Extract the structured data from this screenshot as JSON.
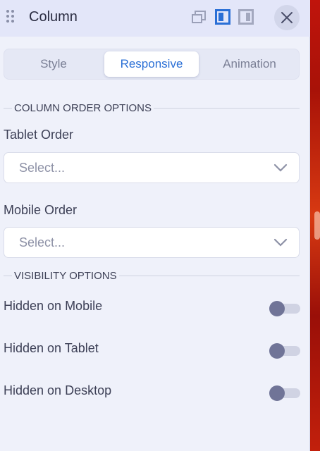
{
  "header": {
    "title": "Column",
    "icons": [
      "drag-handle-icon",
      "overlay-view-icon",
      "sidebar-left-icon",
      "sidebar-right-icon",
      "close-icon"
    ],
    "accent_color": "#2a6fd6"
  },
  "tabs": [
    {
      "label": "Style",
      "active": false
    },
    {
      "label": "Responsive",
      "active": true
    },
    {
      "label": "Animation",
      "active": false
    }
  ],
  "column_order": {
    "section_title": "COLUMN ORDER OPTIONS",
    "tablet_label": "Tablet Order",
    "tablet_placeholder": "Select...",
    "mobile_label": "Mobile Order",
    "mobile_placeholder": "Select..."
  },
  "visibility": {
    "section_title": "VISIBILITY OPTIONS",
    "toggles": [
      {
        "label": "Hidden on Mobile",
        "on": false
      },
      {
        "label": "Hidden on Tablet",
        "on": false
      },
      {
        "label": "Hidden on Desktop",
        "on": false
      }
    ]
  }
}
